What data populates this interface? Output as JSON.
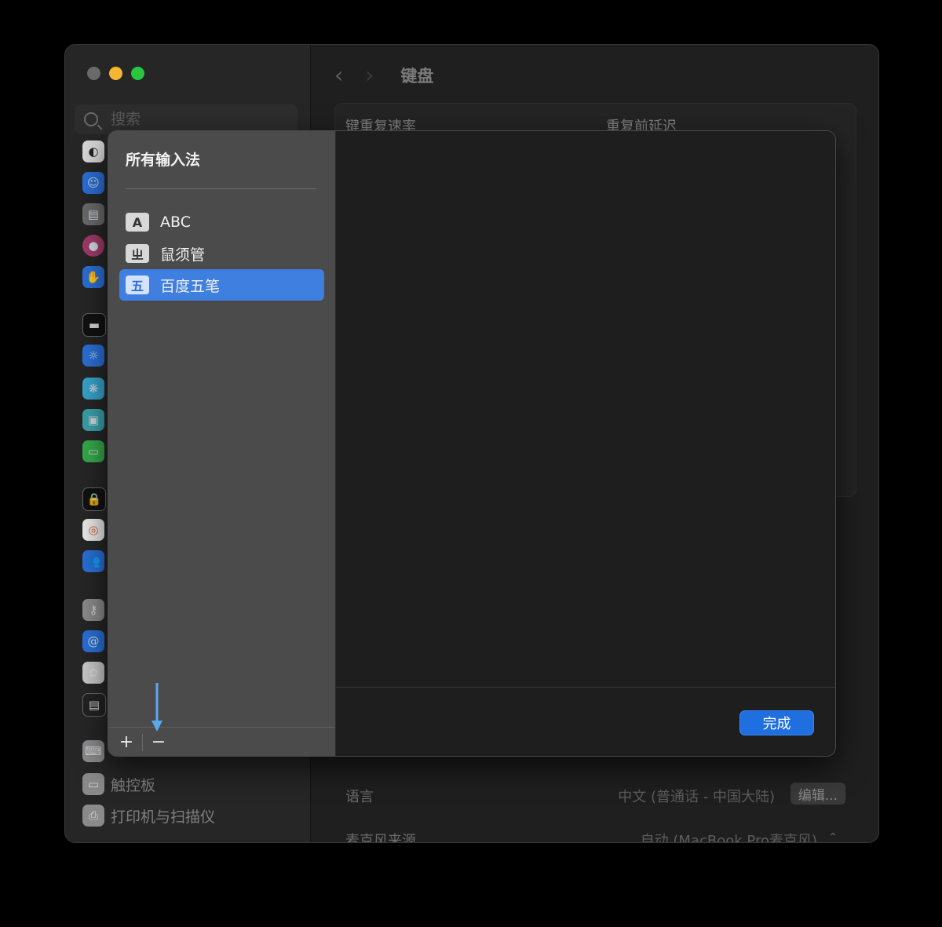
{
  "window": {
    "title": "键盘",
    "colors": {
      "close": "#6a6a6a",
      "minimize": "#f5b731",
      "maximize": "#29c740",
      "accent": "#1f6fe0"
    }
  },
  "sidebar": {
    "search_placeholder": "搜索",
    "items": [
      {
        "label": "",
        "icon": "siri-icon"
      },
      {
        "label": "",
        "icon": "accessibility-icon"
      },
      {
        "label": "",
        "icon": "control-center-icon"
      },
      {
        "label": "",
        "icon": "siri-spotlight-icon"
      },
      {
        "label": "",
        "icon": "privacy-hand-icon"
      },
      {
        "label": "",
        "icon": "desktop-dock-icon"
      },
      {
        "label": "",
        "icon": "displays-icon"
      },
      {
        "label": "",
        "icon": "wallpaper-icon"
      },
      {
        "label": "",
        "icon": "screen-saver-icon"
      },
      {
        "label": "",
        "icon": "battery-icon"
      },
      {
        "label": "",
        "icon": "lock-screen-icon"
      },
      {
        "label": "",
        "icon": "touch-id-icon"
      },
      {
        "label": "",
        "icon": "users-groups-icon"
      },
      {
        "label": "",
        "icon": "passwords-icon"
      },
      {
        "label": "",
        "icon": "internet-accounts-icon"
      },
      {
        "label": "",
        "icon": "game-center-icon"
      },
      {
        "label": "",
        "icon": "wallet-icon"
      },
      {
        "label": "",
        "icon": "keyboard-icon"
      },
      {
        "label": "触控板",
        "icon": "trackpad-icon"
      },
      {
        "label": "打印机与扫描仪",
        "icon": "printer-icon"
      }
    ]
  },
  "main": {
    "key_repeat_label": "键重复速率",
    "delay_label": "重复前延迟",
    "language_label": "语言",
    "language_value": "中文 (普通话 - 中国大陆)",
    "edit_button": "编辑...",
    "mic_label": "麦克风来源",
    "mic_value": "自动 (MacBook Pro麦克风)"
  },
  "sheet": {
    "title": "所有输入法",
    "input_methods": [
      {
        "label": "ABC",
        "icon_glyph": "A",
        "selected": false
      },
      {
        "label": "鼠须管",
        "icon_glyph": "ㄓ",
        "selected": false
      },
      {
        "label": "百度五笔",
        "icon_glyph": "五",
        "selected": true
      }
    ],
    "add_button": "+",
    "remove_button": "−",
    "done_button": "完成"
  }
}
